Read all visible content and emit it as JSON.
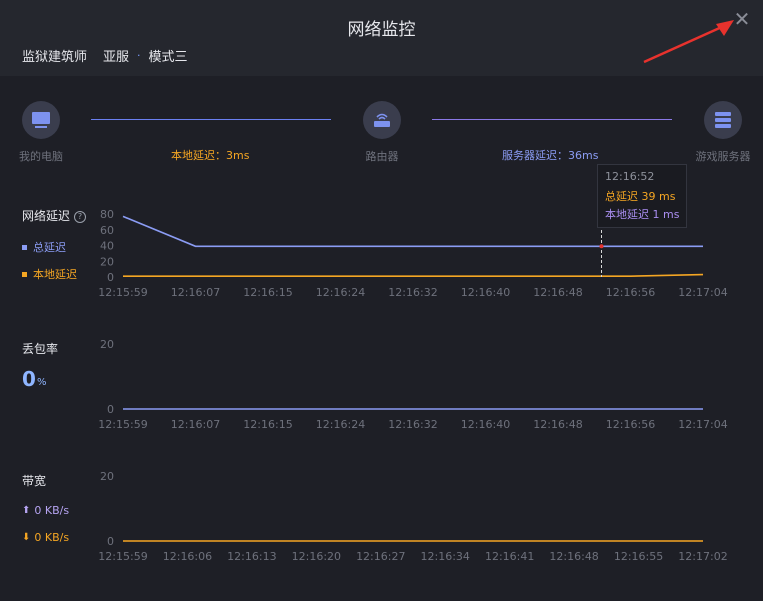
{
  "window": {
    "title": "网络监控"
  },
  "sub": {
    "game": "监狱建筑师",
    "region": "亚服",
    "dot": "·",
    "mode": "模式三"
  },
  "nodes": {
    "pc": "我的电脑",
    "router": "路由器",
    "server": "游戏服务器",
    "local_latency": "本地延迟：3ms",
    "server_latency": "服务器延迟：36ms"
  },
  "latency": {
    "label": "网络延迟",
    "help": "?",
    "legend_total": "总延迟",
    "legend_local": "本地延迟",
    "tooltip": {
      "time": "12:16:52",
      "total": "总延迟 39 ms",
      "local": "本地延迟 1 ms"
    }
  },
  "loss": {
    "label": "丢包率",
    "value": "0",
    "unit": "%"
  },
  "bandwidth": {
    "label": "带宽",
    "up": "0 KB/s",
    "down": "0 KB/s"
  },
  "colors": {
    "accent_blue": "#8b9cf4",
    "local_orange": "#f5a623",
    "purple": "#a98ef0",
    "arrow_red": "#e8322d"
  },
  "chart_data": [
    {
      "type": "line",
      "ylim": [
        0,
        80
      ],
      "yticks": [
        "80",
        "60",
        "40",
        "20",
        "0"
      ],
      "tick_labels": [
        "12:15:59",
        "12:16:07",
        "12:16:15",
        "12:16:24",
        "12:16:32",
        "12:16:40",
        "12:16:48",
        "12:16:56",
        "12:17:04"
      ],
      "x": [
        0,
        1,
        2,
        3,
        4,
        5,
        6,
        7,
        8
      ],
      "series": [
        {
          "name": "总延迟",
          "values": [
            77,
            39,
            39,
            39,
            39,
            39,
            39,
            39,
            39
          ]
        },
        {
          "name": "本地延迟",
          "values": [
            1,
            1,
            1,
            1,
            1,
            1,
            1,
            1,
            3
          ]
        }
      ]
    },
    {
      "type": "line",
      "ylim": [
        0,
        20
      ],
      "yticks": [
        "20",
        "0"
      ],
      "tick_labels": [
        "12:15:59",
        "12:16:07",
        "12:16:15",
        "12:16:24",
        "12:16:32",
        "12:16:40",
        "12:16:48",
        "12:16:56",
        "12:17:04"
      ],
      "series": [
        {
          "values": [
            0,
            0,
            0,
            0,
            0,
            0,
            0,
            0,
            0
          ]
        }
      ]
    },
    {
      "type": "line",
      "ylim": [
        0,
        20
      ],
      "yticks": [
        "20",
        "0"
      ],
      "tick_labels": [
        "12:15:59",
        "12:16:06",
        "12:16:13",
        "12:16:20",
        "12:16:27",
        "12:16:34",
        "12:16:41",
        "12:16:48",
        "12:16:55",
        "12:17:02"
      ],
      "series": [
        {
          "values": [
            0,
            0,
            0,
            0,
            0,
            0,
            0,
            0,
            0,
            0
          ]
        }
      ]
    }
  ]
}
